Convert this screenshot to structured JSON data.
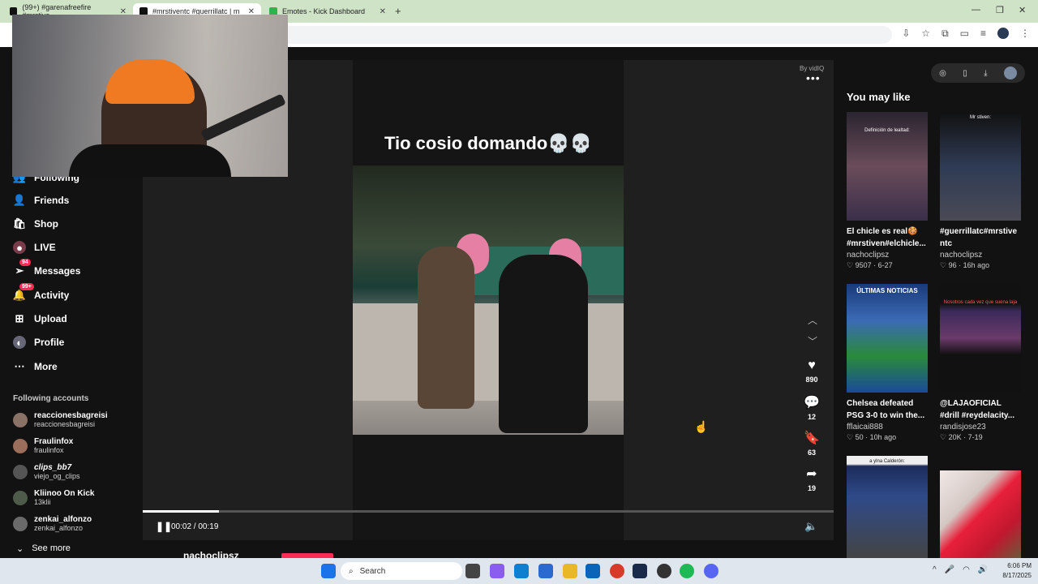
{
  "browser": {
    "tabs": [
      {
        "label": "(99+) #garenafreefire #mrstive",
        "active": false
      },
      {
        "label": "#mrstiventc #guerrillatc | m",
        "active": true
      },
      {
        "label": "Emotes - Kick Dashboard",
        "active": false
      }
    ],
    "new_tab": "+"
  },
  "sidebar": {
    "partial_item": "Following",
    "items": [
      {
        "label": "Friends",
        "icon": "friends-icon"
      },
      {
        "label": "Shop",
        "icon": "shop-icon"
      },
      {
        "label": "LIVE",
        "icon": "live-icon"
      },
      {
        "label": "Messages",
        "icon": "messages-icon",
        "badge": "94"
      },
      {
        "label": "Activity",
        "icon": "activity-icon",
        "badge": "99+"
      },
      {
        "label": "Upload",
        "icon": "upload-icon"
      },
      {
        "label": "Profile",
        "icon": "profile-icon"
      },
      {
        "label": "More",
        "icon": "more-icon"
      }
    ],
    "following_heading": "Following accounts",
    "accounts": [
      {
        "name": "reaccionesbagreisi",
        "handle": "reaccionesbagreisi"
      },
      {
        "name": "Fraulinfox",
        "handle": "fraulinfox"
      },
      {
        "name": "clips_bb7",
        "handle": "viejo_og_clips"
      },
      {
        "name": "Kliinoo On Kick",
        "handle": "13klii"
      },
      {
        "name": "zenkai_alfonzo",
        "handle": "zenkai_alfonzo"
      }
    ],
    "see_more": "See more"
  },
  "player": {
    "byline": "By vidIQ",
    "caption": "Tio cosio domando💀💀",
    "likes": "890",
    "comments": "12",
    "saves": "63",
    "shares": "19",
    "time": "00:02 / 00:19",
    "progress": 0.11,
    "author": "nachoclipsz"
  },
  "right_panel": {
    "heading": "You may like",
    "cards": [
      {
        "thumb_text": "Definición de lealtad:",
        "title": "El chicle es real🍪 #mrstiven#elchicle...",
        "author": "nachoclipsz",
        "meta": "♡ 9507 · 6-27"
      },
      {
        "thumb_text": "Mr stiven:",
        "title": "#guerrillatc#mrstive ntc",
        "author": "nachoclipsz",
        "meta": "♡ 96 · 16h ago"
      },
      {
        "thumb_text": "ÚLTIMAS NOTICIAS",
        "title": "Chelsea defeated PSG 3-0 to win the...",
        "author": "fflaicai888",
        "meta": "♡ 50 · 10h ago"
      },
      {
        "thumb_text": "Nosotros cada vez que suena laja",
        "title": "@LAJAOFICIAL #drill #reydelacity...",
        "author": "randisjose23",
        "meta": "♡ 20K · 7-19"
      },
      {
        "thumb_text": "a ylna Calderón:",
        "title": "",
        "author": "",
        "meta": ""
      },
      {
        "thumb_text": "",
        "title": "",
        "author": "",
        "meta": ""
      }
    ]
  },
  "taskbar": {
    "search": "Search",
    "time": "6:06 PM",
    "date": "8/17/2025"
  },
  "colors": {
    "accent": "#fe2c55",
    "tabbar": "#cfe3c6",
    "background": "#121212"
  }
}
